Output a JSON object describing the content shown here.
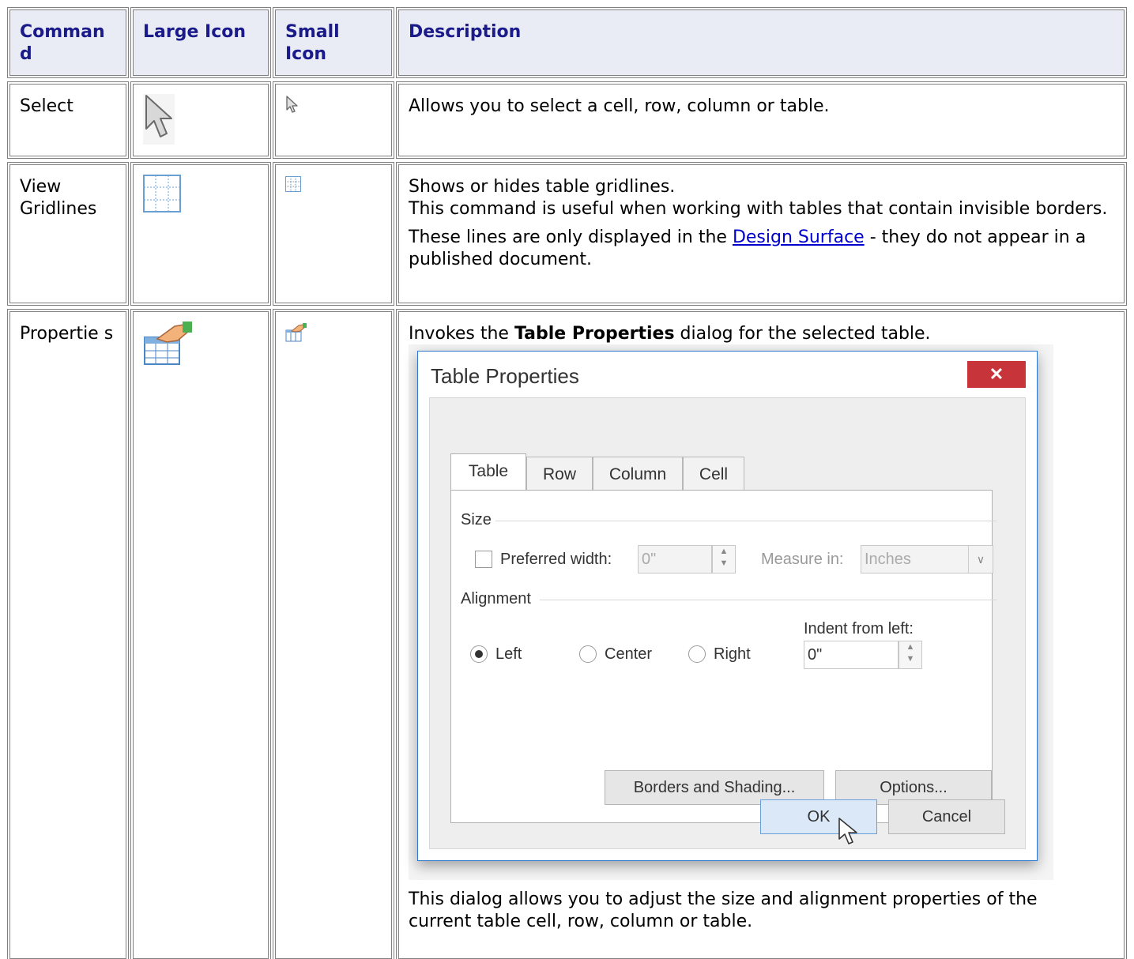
{
  "table": {
    "headers": [
      "Comman d",
      "Large Icon",
      "Small Icon",
      "Description"
    ],
    "rows": [
      {
        "command": "Select",
        "large_icon": "arrow-pointer-icon",
        "small_icon": "arrow-pointer-icon",
        "description": "Allows you to select a cell, row, column or table."
      },
      {
        "command": "View Gridlines",
        "large_icon": "grid-icon",
        "small_icon": "grid-icon",
        "description_line1": "Shows or hides table gridlines.",
        "description_line2": "This command is useful when working with tables that contain invisible borders.",
        "description_line3_before": "These lines are only displayed in the",
        "description_link": "Design Surface",
        "description_line3_after": "- they do not appear in a published document."
      },
      {
        "command": "Propertie s",
        "large_icon": "table-properties-icon",
        "small_icon": "table-properties-icon",
        "description_before": "Invokes the",
        "description_bold": "Table Properties",
        "description_after": "dialog for the selected table.",
        "description_footer": "This dialog allows you to adjust the size and alignment properties of the current table cell, row, column or table."
      }
    ]
  },
  "dialog": {
    "title": "Table Properties",
    "close_label": "✕",
    "tabs": [
      "Table",
      "Row",
      "Column",
      "Cell"
    ],
    "active_tab": "Table",
    "size_group": "Size",
    "preferred_width_label": "Preferred width:",
    "preferred_width_value": "0\"",
    "measure_in_label": "Measure in:",
    "measure_in_value": "Inches",
    "alignment_group": "Alignment",
    "alignment_options": [
      "Left",
      "Center",
      "Right"
    ],
    "alignment_selected": "Left",
    "indent_label": "Indent from left:",
    "indent_value": "0\"",
    "borders_button": "Borders and Shading...",
    "options_button": "Options...",
    "ok_button": "OK",
    "cancel_button": "Cancel"
  },
  "colors": {
    "header_bg": "#e9ecf5",
    "header_text": "#1a1a8a",
    "close_button": "#c7353a",
    "link": "#0000cc"
  }
}
